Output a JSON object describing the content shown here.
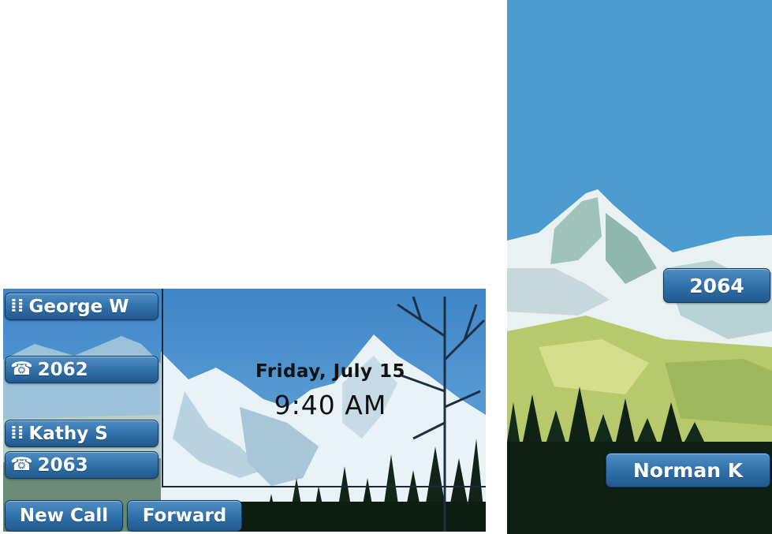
{
  "main_screen": {
    "lines": [
      {
        "icon": "keypad-icon",
        "label": "George W"
      },
      {
        "icon": "phone-icon",
        "label": "2062"
      },
      {
        "icon": "keypad-icon",
        "label": "Kathy S"
      },
      {
        "icon": "phone-icon",
        "label": "2063"
      }
    ],
    "date": "Friday, July 15",
    "time": "9:40 AM",
    "softkeys": [
      "New Call",
      "Forward"
    ]
  },
  "side_screen": {
    "buttons": [
      "2064",
      "Norman K"
    ]
  },
  "icons": {
    "keypad": "⁞⁞",
    "phone": "☎"
  },
  "colors": {
    "button": "#2f6fa8",
    "sky": "#4d93cf",
    "text_dark": "#111111"
  }
}
